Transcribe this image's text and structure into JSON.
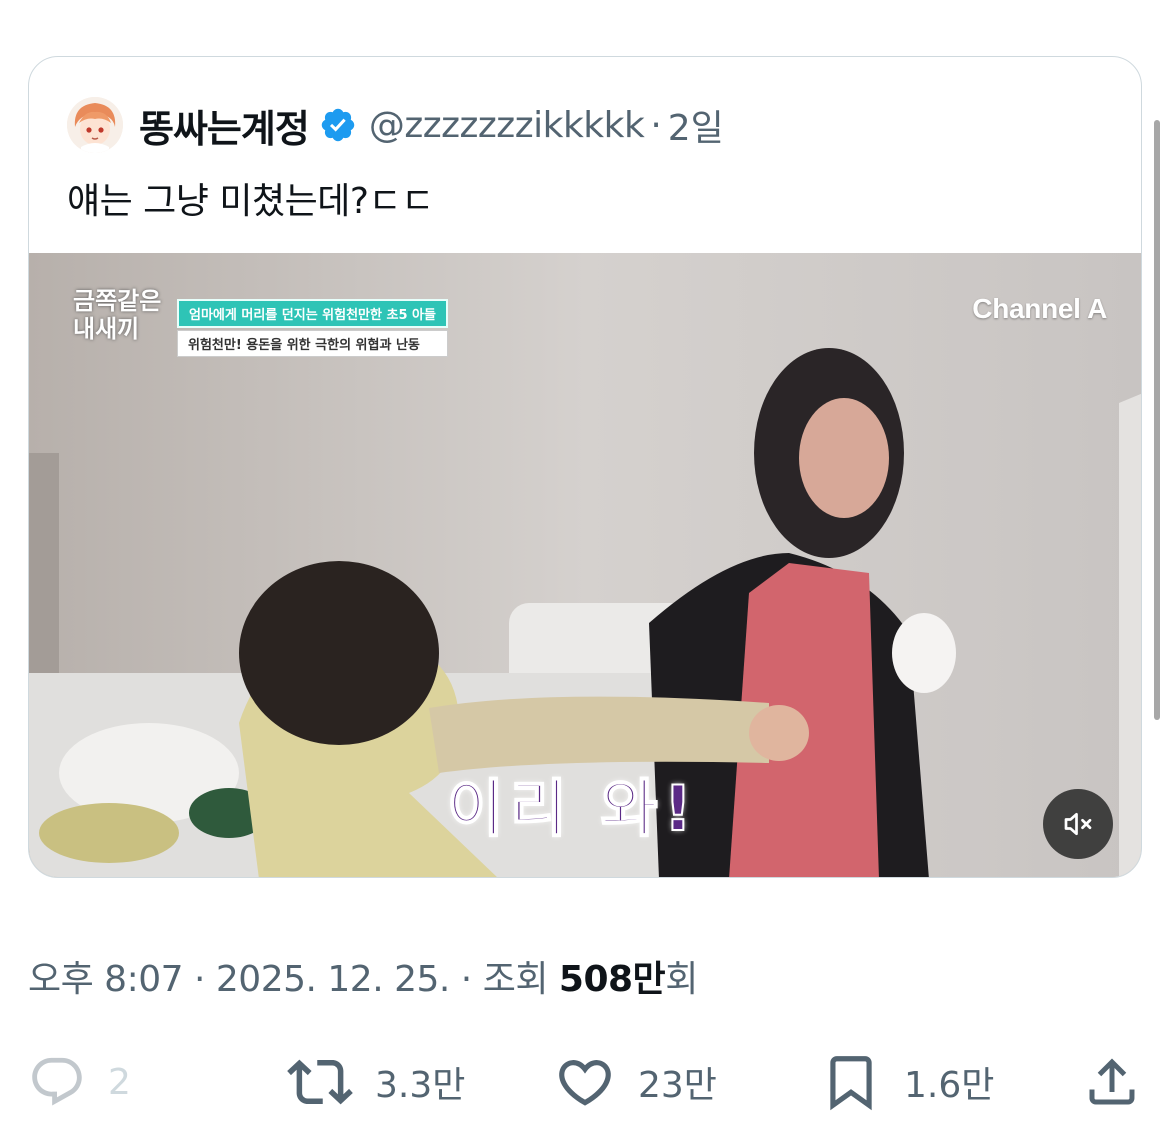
{
  "quoted_tweet": {
    "display_name": "똥싸는계정",
    "handle": "@zzzzzzzikkkkk",
    "separator": "·",
    "time": "2일",
    "text": "얘는 그냥 미쳤는데?ㄷㄷ",
    "media": {
      "broadcaster_logo": "Channel A",
      "show_logo_line1": "금쪽같은",
      "show_logo_line2": "내새끼",
      "caption_line1": "엄마에게 머리를 던지는 위험천만한 초5 아들",
      "caption_line2": "위험천만! 용돈을 위한 극한의 위협과 난동",
      "subtitle": "이리 와!",
      "mute_icon": "speaker-muted-icon"
    }
  },
  "meta": {
    "time": "오후 8:07",
    "sep1": "·",
    "date": "2025. 12. 25.",
    "sep2": "·",
    "views_label": "조회",
    "views_value": "508만",
    "views_suffix": "회"
  },
  "actions": {
    "reply_count": "2",
    "retweet_count": "3.3만",
    "like_count": "23만",
    "bookmark_count": "1.6만"
  },
  "colors": {
    "verified": "#1d9bf0",
    "secondary_text": "#536471",
    "border": "#cfd9de"
  }
}
